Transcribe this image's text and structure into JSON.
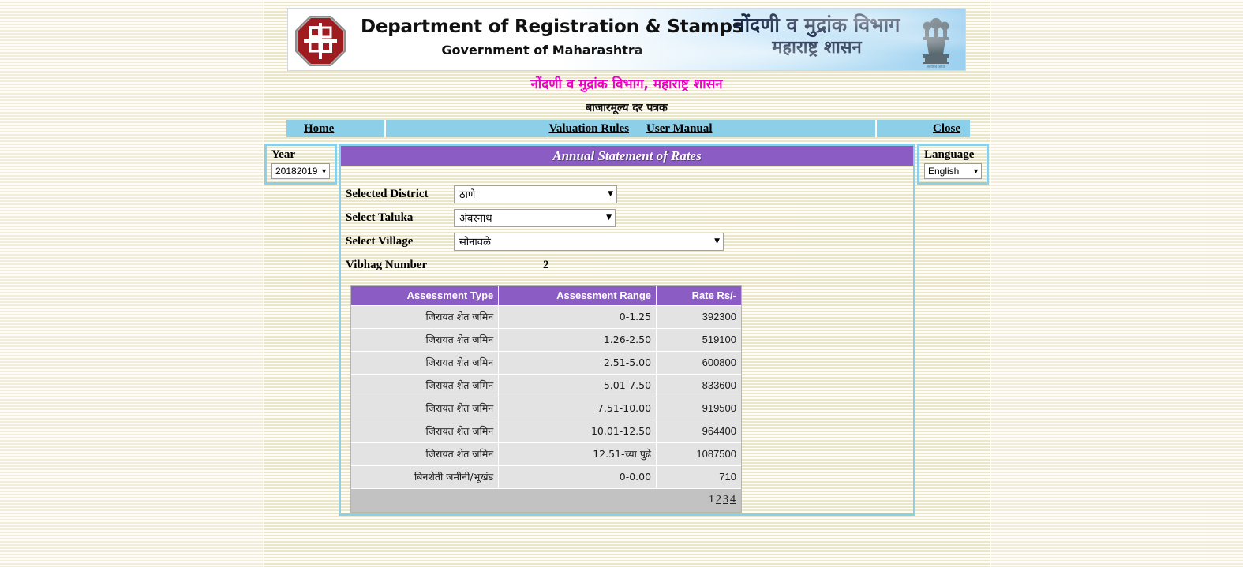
{
  "banner": {
    "logo_icon": "registration-stamps-logo-icon",
    "title_en_line1": "Department of Registration & Stamps",
    "title_en_line2": "Government of Maharashtra",
    "title_mr_line1": "नोंदणी व मुद्रांक विभाग",
    "title_mr_line2": "महाराष्ट्र शासन",
    "emblem_icon": "ashoka-emblem-icon"
  },
  "headings": {
    "marathi_title": "नोंदणी व मुद्रांक विभाग, महाराष्ट्र शासन",
    "subtitle": "बाजारमूल्य दर पत्रक",
    "marathi_title_color": "#ee00c8"
  },
  "nav": {
    "home": "Home",
    "valuation_rules": "Valuation Rules",
    "user_manual": "User Manual",
    "close": "Close",
    "bar_color": "#8ccfe8"
  },
  "year_box": {
    "label": "Year",
    "selected": "20182019"
  },
  "language_box": {
    "label": "Language",
    "selected": "English"
  },
  "panel": {
    "title": "Annual Statement of Rates",
    "title_bg": "#8a5cc4",
    "border_color": "#8ccfe8"
  },
  "form": {
    "district_label": "Selected District",
    "district_value": "ठाणे",
    "taluka_label": "Select Taluka",
    "taluka_value": "अंबरनाथ",
    "village_label": "Select Village",
    "village_value": "सोनावळे",
    "vibhag_label": "Vibhag Number",
    "vibhag_value": "2"
  },
  "table": {
    "headers": {
      "type": "Assessment Type",
      "range": "Assessment Range",
      "rate": "Rate Rs/-"
    },
    "rows": [
      {
        "type": "जिरायत शेत जमिन",
        "range": "0-1.25",
        "rate": "392300"
      },
      {
        "type": "जिरायत शेत जमिन",
        "range": "1.26-2.50",
        "rate": "519100"
      },
      {
        "type": "जिरायत शेत जमिन",
        "range": "2.51-5.00",
        "rate": "600800"
      },
      {
        "type": "जिरायत शेत जमिन",
        "range": "5.01-7.50",
        "rate": "833600"
      },
      {
        "type": "जिरायत शेत जमिन",
        "range": "7.51-10.00",
        "rate": "919500"
      },
      {
        "type": "जिरायत शेत जमिन",
        "range": "10.01-12.50",
        "rate": "964400"
      },
      {
        "type": "जिरायत शेत जमिन",
        "range": "12.51-च्या पुढे",
        "rate": "1087500"
      },
      {
        "type": "बिनशेती जमीनी/भूखंड",
        "range": "0-0.00",
        "rate": "710"
      }
    ],
    "pagination": {
      "current": "1",
      "links": [
        "2",
        "3",
        "4"
      ]
    },
    "header_bg": "#8a5cc4",
    "row_bg": "#e3e3e3",
    "pager_bg": "#c2c2c2"
  },
  "icons": {
    "caret": "▼"
  }
}
